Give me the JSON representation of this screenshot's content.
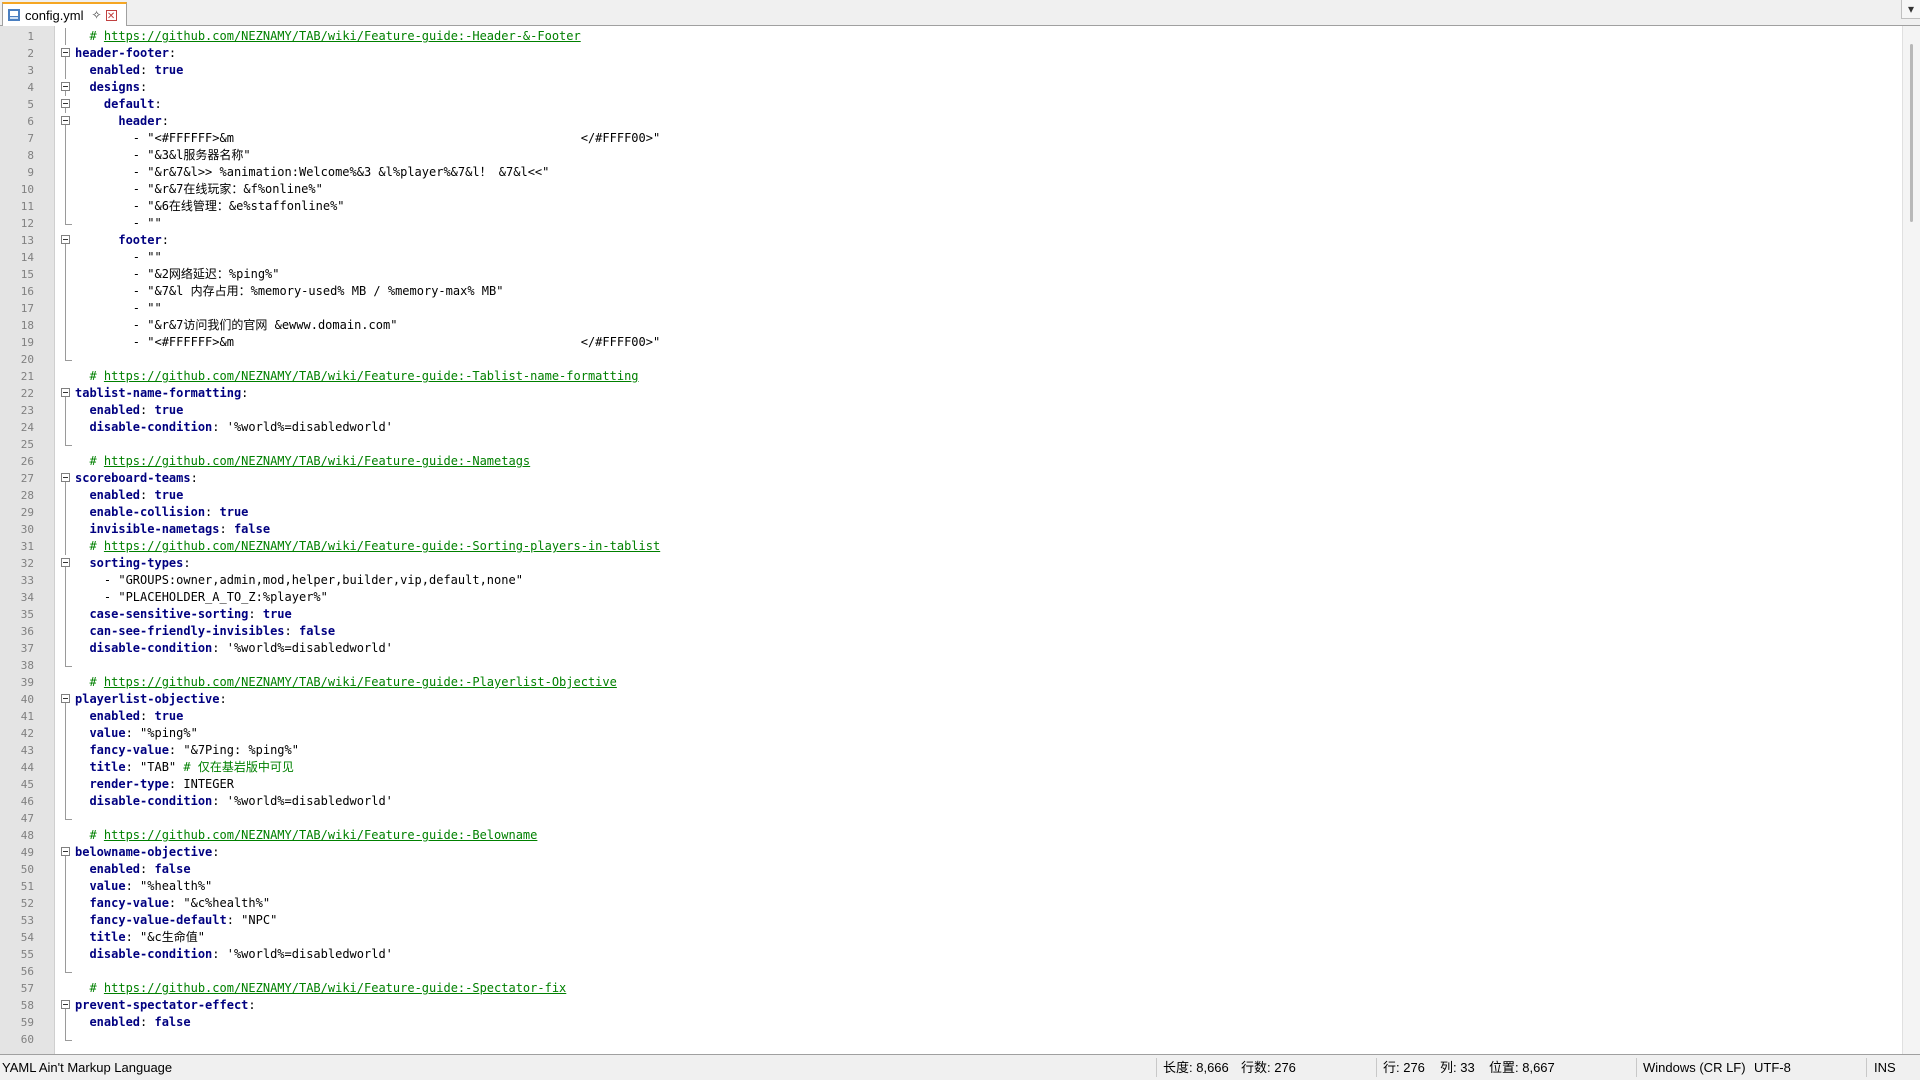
{
  "tab": {
    "filename": "config.yml",
    "pin_glyph": "✧",
    "close_glyph": "✕"
  },
  "tabbar_menu_glyph": "▾",
  "lines": [
    {
      "n": "1",
      "fold": "vline",
      "t": [
        {
          "c": "",
          "x": "  "
        },
        {
          "c": "c",
          "x": "# "
        },
        {
          "c": "url",
          "x": "https://github.com/NEZNAMY/TAB/wiki/Feature-guide:-Header-&-Footer"
        }
      ]
    },
    {
      "n": "2",
      "fold": "box",
      "t": [
        {
          "c": "k",
          "x": "header-footer"
        },
        {
          "c": "",
          "x": ":"
        }
      ]
    },
    {
      "n": "3",
      "fold": "vline",
      "t": [
        {
          "c": "k",
          "x": "  enabled"
        },
        {
          "c": "",
          "x": ": "
        },
        {
          "c": "v",
          "x": "true"
        }
      ]
    },
    {
      "n": "4",
      "fold": "box",
      "t": [
        {
          "c": "k",
          "x": "  designs"
        },
        {
          "c": "",
          "x": ":"
        }
      ]
    },
    {
      "n": "5",
      "fold": "box",
      "t": [
        {
          "c": "k",
          "x": "    default"
        },
        {
          "c": "",
          "x": ":"
        }
      ]
    },
    {
      "n": "6",
      "fold": "box",
      "t": [
        {
          "c": "k",
          "x": "      header"
        },
        {
          "c": "",
          "x": ":"
        }
      ]
    },
    {
      "n": "7",
      "fold": "vline",
      "t": [
        {
          "c": "",
          "x": "        - \"<#FFFFFF>&m                                                </#FFFF00>\""
        }
      ]
    },
    {
      "n": "8",
      "fold": "vline",
      "t": [
        {
          "c": "",
          "x": "        - \"&3&l服务器名称\""
        }
      ]
    },
    {
      "n": "9",
      "fold": "vline",
      "t": [
        {
          "c": "",
          "x": "        - \"&r&7&l>> %animation:Welcome%&3 &l%player%&7&l！ &7&l<<\""
        }
      ]
    },
    {
      "n": "10",
      "fold": "vline",
      "t": [
        {
          "c": "",
          "x": "        - \"&r&7在线玩家：&f%online%\""
        }
      ]
    },
    {
      "n": "11",
      "fold": "vline",
      "t": [
        {
          "c": "",
          "x": "        - \"&6在线管理：&e%staffonline%\""
        }
      ]
    },
    {
      "n": "12",
      "fold": "corner",
      "t": [
        {
          "c": "",
          "x": "        - \"\""
        }
      ]
    },
    {
      "n": "13",
      "fold": "box",
      "t": [
        {
          "c": "k",
          "x": "      footer"
        },
        {
          "c": "",
          "x": ":"
        }
      ]
    },
    {
      "n": "14",
      "fold": "vline",
      "t": [
        {
          "c": "",
          "x": "        - \"\""
        }
      ]
    },
    {
      "n": "15",
      "fold": "vline",
      "t": [
        {
          "c": "",
          "x": "        - \"&2网络延迟：%ping%\""
        }
      ]
    },
    {
      "n": "16",
      "fold": "vline",
      "t": [
        {
          "c": "",
          "x": "        - \"&7&l 内存占用：%memory-used% MB / %memory-max% MB\""
        }
      ]
    },
    {
      "n": "17",
      "fold": "vline",
      "t": [
        {
          "c": "",
          "x": "        - \"\""
        }
      ]
    },
    {
      "n": "18",
      "fold": "vline",
      "t": [
        {
          "c": "",
          "x": "        - \"&r&7访问我们的官网 &ewww.domain.com\""
        }
      ]
    },
    {
      "n": "19",
      "fold": "vline",
      "t": [
        {
          "c": "",
          "x": "        - \"<#FFFFFF>&m                                                </#FFFF00>\""
        }
      ]
    },
    {
      "n": "20",
      "fold": "corner",
      "t": []
    },
    {
      "n": "21",
      "fold": "",
      "t": [
        {
          "c": "",
          "x": "  "
        },
        {
          "c": "c",
          "x": "# "
        },
        {
          "c": "url",
          "x": "https://github.com/NEZNAMY/TAB/wiki/Feature-guide:-Tablist-name-formatting"
        }
      ]
    },
    {
      "n": "22",
      "fold": "box",
      "t": [
        {
          "c": "k",
          "x": "tablist-name-formatting"
        },
        {
          "c": "",
          "x": ":"
        }
      ]
    },
    {
      "n": "23",
      "fold": "vline",
      "t": [
        {
          "c": "k",
          "x": "  enabled"
        },
        {
          "c": "",
          "x": ": "
        },
        {
          "c": "v",
          "x": "true"
        }
      ]
    },
    {
      "n": "24",
      "fold": "vline",
      "t": [
        {
          "c": "k",
          "x": "  disable-condition"
        },
        {
          "c": "",
          "x": ": '%world%=disabledworld'"
        }
      ]
    },
    {
      "n": "25",
      "fold": "corner",
      "t": []
    },
    {
      "n": "26",
      "fold": "",
      "t": [
        {
          "c": "",
          "x": "  "
        },
        {
          "c": "c",
          "x": "# "
        },
        {
          "c": "url",
          "x": "https://github.com/NEZNAMY/TAB/wiki/Feature-guide:-Nametags"
        }
      ]
    },
    {
      "n": "27",
      "fold": "box",
      "t": [
        {
          "c": "k",
          "x": "scoreboard-teams"
        },
        {
          "c": "",
          "x": ":"
        }
      ]
    },
    {
      "n": "28",
      "fold": "vline",
      "t": [
        {
          "c": "k",
          "x": "  enabled"
        },
        {
          "c": "",
          "x": ": "
        },
        {
          "c": "v",
          "x": "true"
        }
      ]
    },
    {
      "n": "29",
      "fold": "vline",
      "t": [
        {
          "c": "k",
          "x": "  enable-collision"
        },
        {
          "c": "",
          "x": ": "
        },
        {
          "c": "v",
          "x": "true"
        }
      ]
    },
    {
      "n": "30",
      "fold": "vline",
      "t": [
        {
          "c": "k",
          "x": "  invisible-nametags"
        },
        {
          "c": "",
          "x": ": "
        },
        {
          "c": "v",
          "x": "false"
        }
      ]
    },
    {
      "n": "31",
      "fold": "vline",
      "t": [
        {
          "c": "",
          "x": "  "
        },
        {
          "c": "c",
          "x": "# "
        },
        {
          "c": "url",
          "x": "https://github.com/NEZNAMY/TAB/wiki/Feature-guide:-Sorting-players-in-tablist"
        }
      ]
    },
    {
      "n": "32",
      "fold": "box",
      "t": [
        {
          "c": "k",
          "x": "  sorting-types"
        },
        {
          "c": "",
          "x": ":"
        }
      ]
    },
    {
      "n": "33",
      "fold": "vline",
      "t": [
        {
          "c": "",
          "x": "    - \"GROUPS:owner,admin,mod,helper,builder,vip,default,none\""
        }
      ]
    },
    {
      "n": "34",
      "fold": "vline",
      "t": [
        {
          "c": "",
          "x": "    - \"PLACEHOLDER_A_TO_Z:%player%\""
        }
      ]
    },
    {
      "n": "35",
      "fold": "vline",
      "t": [
        {
          "c": "k",
          "x": "  case-sensitive-sorting"
        },
        {
          "c": "",
          "x": ": "
        },
        {
          "c": "v",
          "x": "true"
        }
      ]
    },
    {
      "n": "36",
      "fold": "vline",
      "t": [
        {
          "c": "k",
          "x": "  can-see-friendly-invisibles"
        },
        {
          "c": "",
          "x": ": "
        },
        {
          "c": "v",
          "x": "false"
        }
      ]
    },
    {
      "n": "37",
      "fold": "vline",
      "t": [
        {
          "c": "k",
          "x": "  disable-condition"
        },
        {
          "c": "",
          "x": ": '%world%=disabledworld'"
        }
      ]
    },
    {
      "n": "38",
      "fold": "corner",
      "t": []
    },
    {
      "n": "39",
      "fold": "",
      "t": [
        {
          "c": "",
          "x": "  "
        },
        {
          "c": "c",
          "x": "# "
        },
        {
          "c": "url",
          "x": "https://github.com/NEZNAMY/TAB/wiki/Feature-guide:-Playerlist-Objective"
        }
      ]
    },
    {
      "n": "40",
      "fold": "box",
      "t": [
        {
          "c": "k",
          "x": "playerlist-objective"
        },
        {
          "c": "",
          "x": ":"
        }
      ]
    },
    {
      "n": "41",
      "fold": "vline",
      "t": [
        {
          "c": "k",
          "x": "  enabled"
        },
        {
          "c": "",
          "x": ": "
        },
        {
          "c": "v",
          "x": "true"
        }
      ]
    },
    {
      "n": "42",
      "fold": "vline",
      "t": [
        {
          "c": "k",
          "x": "  value"
        },
        {
          "c": "",
          "x": ": \"%ping%\""
        }
      ]
    },
    {
      "n": "43",
      "fold": "vline",
      "t": [
        {
          "c": "k",
          "x": "  fancy-value"
        },
        {
          "c": "",
          "x": ": \"&7Ping: %ping%\""
        }
      ]
    },
    {
      "n": "44",
      "fold": "vline",
      "t": [
        {
          "c": "k",
          "x": "  title"
        },
        {
          "c": "",
          "x": ": \"TAB\" "
        },
        {
          "c": "c",
          "x": "# 仅在基岩版中可见"
        }
      ]
    },
    {
      "n": "45",
      "fold": "vline",
      "t": [
        {
          "c": "k",
          "x": "  render-type"
        },
        {
          "c": "",
          "x": ": INTEGER"
        }
      ]
    },
    {
      "n": "46",
      "fold": "vline",
      "t": [
        {
          "c": "k",
          "x": "  disable-condition"
        },
        {
          "c": "",
          "x": ": '%world%=disabledworld'"
        }
      ]
    },
    {
      "n": "47",
      "fold": "corner",
      "t": []
    },
    {
      "n": "48",
      "fold": "",
      "t": [
        {
          "c": "",
          "x": "  "
        },
        {
          "c": "c",
          "x": "# "
        },
        {
          "c": "url",
          "x": "https://github.com/NEZNAMY/TAB/wiki/Feature-guide:-Belowname"
        }
      ]
    },
    {
      "n": "49",
      "fold": "box",
      "t": [
        {
          "c": "k",
          "x": "belowname-objective"
        },
        {
          "c": "",
          "x": ":"
        }
      ]
    },
    {
      "n": "50",
      "fold": "vline",
      "t": [
        {
          "c": "k",
          "x": "  enabled"
        },
        {
          "c": "",
          "x": ": "
        },
        {
          "c": "v",
          "x": "false"
        }
      ]
    },
    {
      "n": "51",
      "fold": "vline",
      "t": [
        {
          "c": "k",
          "x": "  value"
        },
        {
          "c": "",
          "x": ": \"%health%\""
        }
      ]
    },
    {
      "n": "52",
      "fold": "vline",
      "t": [
        {
          "c": "k",
          "x": "  fancy-value"
        },
        {
          "c": "",
          "x": ": \"&c%health%\""
        }
      ]
    },
    {
      "n": "53",
      "fold": "vline",
      "t": [
        {
          "c": "k",
          "x": "  fancy-value-default"
        },
        {
          "c": "",
          "x": ": \"NPC\""
        }
      ]
    },
    {
      "n": "54",
      "fold": "vline",
      "t": [
        {
          "c": "k",
          "x": "  title"
        },
        {
          "c": "",
          "x": ": \"&c生命值\""
        }
      ]
    },
    {
      "n": "55",
      "fold": "vline",
      "t": [
        {
          "c": "k",
          "x": "  disable-condition"
        },
        {
          "c": "",
          "x": ": '%world%=disabledworld'"
        }
      ]
    },
    {
      "n": "56",
      "fold": "corner",
      "t": []
    },
    {
      "n": "57",
      "fold": "",
      "t": [
        {
          "c": "",
          "x": "  "
        },
        {
          "c": "c",
          "x": "# "
        },
        {
          "c": "url",
          "x": "https://github.com/NEZNAMY/TAB/wiki/Feature-guide:-Spectator-fix"
        }
      ]
    },
    {
      "n": "58",
      "fold": "box",
      "t": [
        {
          "c": "k",
          "x": "prevent-spectator-effect"
        },
        {
          "c": "",
          "x": ":"
        }
      ]
    },
    {
      "n": "59",
      "fold": "vline",
      "t": [
        {
          "c": "k",
          "x": "  enabled"
        },
        {
          "c": "",
          "x": ": "
        },
        {
          "c": "v",
          "x": "false"
        }
      ]
    },
    {
      "n": "60",
      "fold": "corner",
      "t": []
    }
  ],
  "status": {
    "language": "YAML Ain't Markup Language",
    "length": "长度: 8,666",
    "lines": "行数: 276",
    "row": "行: 276",
    "col": "列: 33",
    "pos": "位置: 8,667",
    "eol": "Windows (CR LF)",
    "encoding": "UTF-8",
    "mode": "INS"
  }
}
